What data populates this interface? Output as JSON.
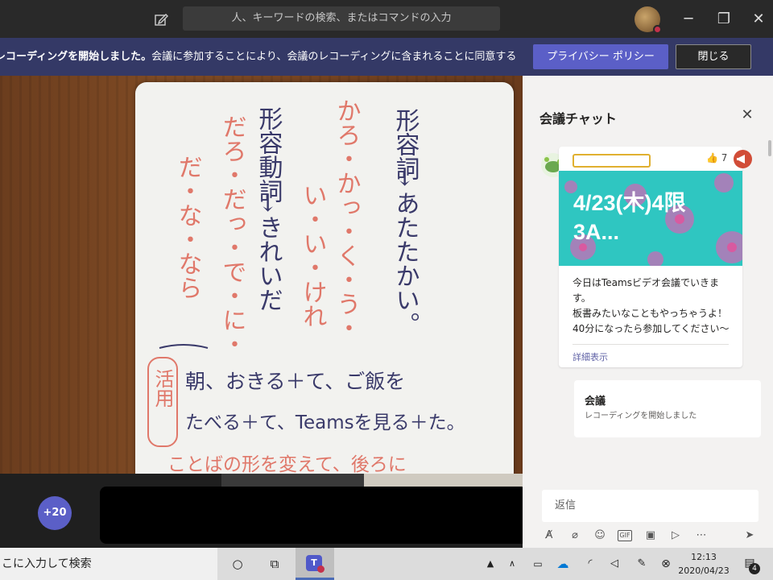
{
  "titlebar": {
    "search_placeholder": "人、キーワードの検索、またはコマンドの入力",
    "minimize": "─",
    "maximize": "❐",
    "close": "✕"
  },
  "banner": {
    "bold_text": "レコーディングを開始しました。",
    "text": "会議に参加することにより、会議のレコーディングに含まれることに同意することを示しま...",
    "privacy_button": "プライバシー ポリシー",
    "close_button": "閉じる"
  },
  "whiteboard": {
    "col1_title": "形容詞",
    "col1_arrow": "↓",
    "col1_word": "あたたかい。",
    "col2_forms": "かろ・かっ・く・う・",
    "col3_forms": "い・い・けれ",
    "col4_title": "形容動詞",
    "col4_arrow": "↓",
    "col4_word": "きれいだ",
    "col5_forms": "だろ・だっ・で・に・",
    "col6_forms": "だ・な・なら",
    "katsuyou_label": "活用",
    "line1": "朝、おきる＋て、ご飯を",
    "line2": "たべる＋て、Teamsを見る＋た。",
    "line3": "ことばの形を変えて、後ろに"
  },
  "controls": {
    "participants_more": "+20"
  },
  "chat": {
    "title": "会議チャット",
    "close_icon": "✕",
    "like_count": "👍 7",
    "banner_title": "4/23(木)4限　3A...",
    "message_lines": [
      "今日はTeamsビデオ会議でいきま",
      "す。",
      "板書みたいなこともやっちゃうよ！",
      "40分になったら参加してください〜"
    ],
    "more_link": "詳細表示",
    "event_title": "会議",
    "event_text": "レコーディングを開始しました",
    "reply_placeholder": "返信",
    "accent_color": "#5b5fc7",
    "banner_color": "#2fc6c1"
  },
  "taskbar": {
    "search_text": "こに入力して検索",
    "time": "12:13",
    "date": "2020/04/23",
    "notification_count": "4"
  }
}
